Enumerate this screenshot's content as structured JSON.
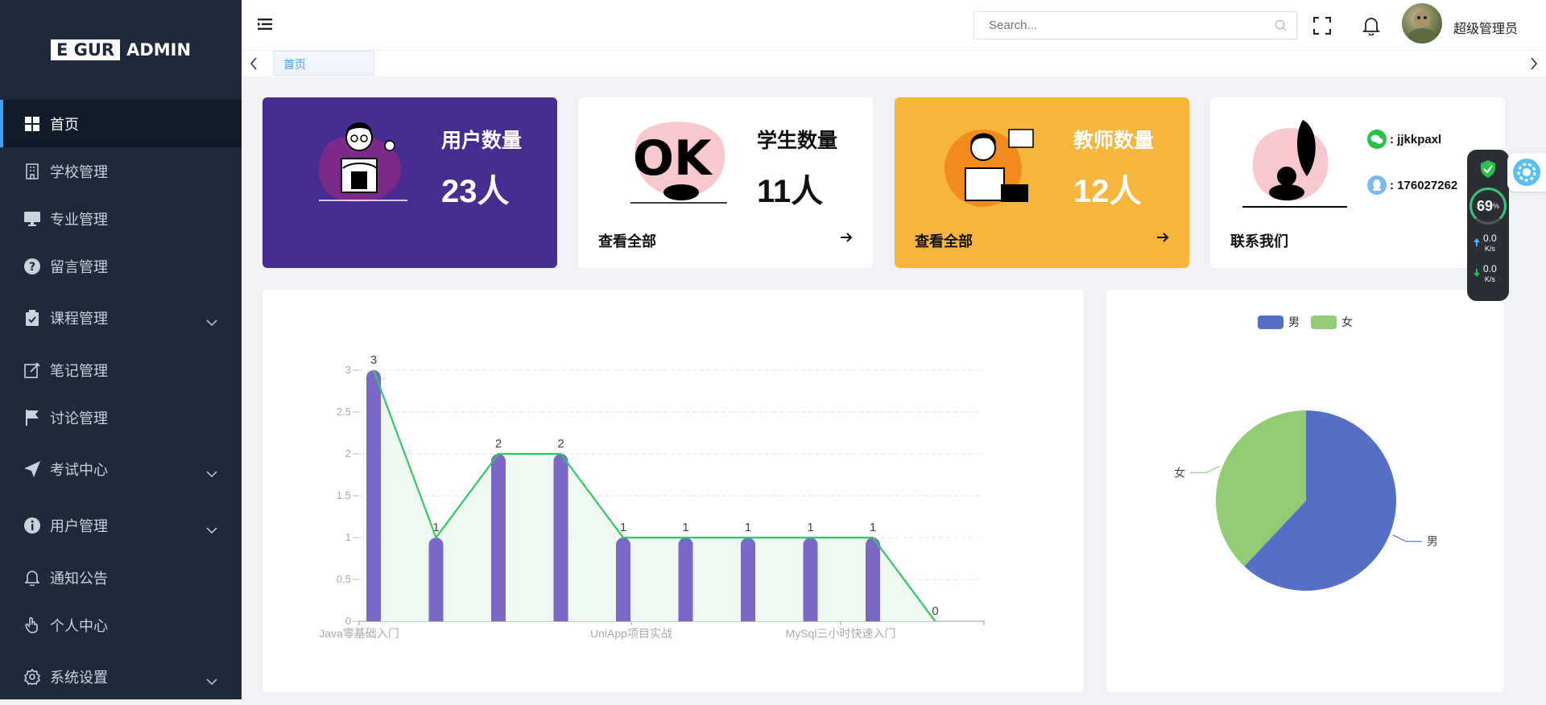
{
  "brand": {
    "logo_left": "E GUR",
    "logo_right": "ADMIN"
  },
  "sidebar": {
    "items": [
      {
        "label": "首页",
        "icon": "dashboard-icon",
        "active": true
      },
      {
        "label": "学校管理",
        "icon": "building-icon"
      },
      {
        "label": "专业管理",
        "icon": "monitor-icon"
      },
      {
        "label": "留言管理",
        "icon": "question-icon"
      },
      {
        "label": "课程管理",
        "icon": "clipboard-icon",
        "expandable": true
      },
      {
        "label": "笔记管理",
        "icon": "edit-icon"
      },
      {
        "label": "讨论管理",
        "icon": "flag-icon"
      },
      {
        "label": "考试中心",
        "icon": "send-icon",
        "expandable": true
      },
      {
        "label": "用户管理",
        "icon": "info-icon",
        "expandable": true
      },
      {
        "label": "通知公告",
        "icon": "bell-icon"
      },
      {
        "label": "个人中心",
        "icon": "hand-icon"
      },
      {
        "label": "系统设置",
        "icon": "gear-icon",
        "expandable": true
      }
    ]
  },
  "header": {
    "search_placeholder": "Search...",
    "username": "超级管理员"
  },
  "tabs": [
    {
      "label": "首页"
    }
  ],
  "cards": {
    "users": {
      "title": "用户数量",
      "value": "23人",
      "bg": "#472d91"
    },
    "students": {
      "title": "学生数量",
      "value": "11人",
      "link": "查看全部"
    },
    "teachers": {
      "title": "教师数量",
      "value": "12人",
      "link": "查看全部",
      "bg": "#f6b53d"
    },
    "contact": {
      "wechat": "jjkkpaxl",
      "qq": "176027262",
      "link": "联系我们"
    }
  },
  "widget": {
    "percent": "69",
    "percent_unit": "%",
    "up_speed": "0.0",
    "down_speed": "0.0",
    "unit": "K/s"
  },
  "chart_data": [
    {
      "type": "bar",
      "categories": [
        "Java零基础入门",
        "",
        "",
        "",
        "UniApp项目实战",
        "",
        "",
        "",
        "MySql三小时快速入门",
        ""
      ],
      "x_tick_labels": [
        "Java零基础入门",
        "UniApp项目实战",
        "MySql三小时快速入门"
      ],
      "series": [
        {
          "type": "bar",
          "values": [
            3,
            1,
            2,
            2,
            1,
            1,
            1,
            1,
            1,
            0
          ],
          "color": "#7b68c6"
        },
        {
          "type": "line",
          "values": [
            3,
            1,
            2,
            2,
            1,
            1,
            1,
            1,
            1,
            0
          ],
          "color": "#36c46b"
        }
      ],
      "yticks": [
        "0",
        "0.5",
        "1",
        "1.5",
        "2",
        "2.5",
        "3"
      ],
      "ylim": [
        0,
        3
      ],
      "grid": true
    },
    {
      "type": "pie",
      "labels": [
        "男",
        "女"
      ],
      "values": [
        62,
        38
      ],
      "colors": [
        "#5470c6",
        "#91cc75"
      ],
      "legend": "top"
    }
  ]
}
